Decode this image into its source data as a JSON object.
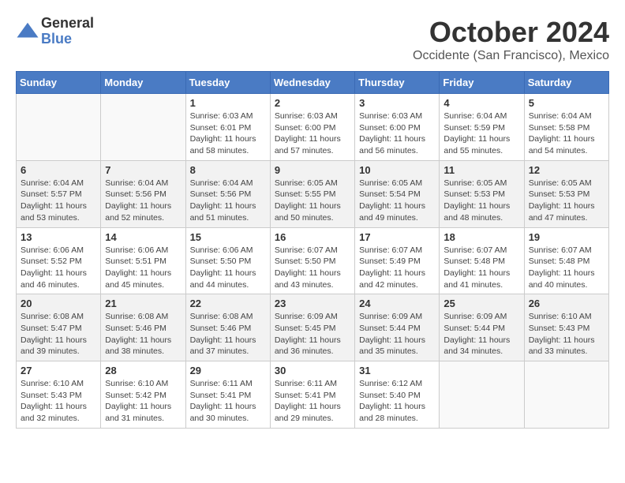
{
  "logo": {
    "general": "General",
    "blue": "Blue"
  },
  "title": "October 2024",
  "location": "Occidente (San Francisco), Mexico",
  "headers": [
    "Sunday",
    "Monday",
    "Tuesday",
    "Wednesday",
    "Thursday",
    "Friday",
    "Saturday"
  ],
  "weeks": [
    [
      {
        "day": "",
        "sunrise": "",
        "sunset": "",
        "daylight": ""
      },
      {
        "day": "",
        "sunrise": "",
        "sunset": "",
        "daylight": ""
      },
      {
        "day": "1",
        "sunrise": "Sunrise: 6:03 AM",
        "sunset": "Sunset: 6:01 PM",
        "daylight": "Daylight: 11 hours and 58 minutes."
      },
      {
        "day": "2",
        "sunrise": "Sunrise: 6:03 AM",
        "sunset": "Sunset: 6:00 PM",
        "daylight": "Daylight: 11 hours and 57 minutes."
      },
      {
        "day": "3",
        "sunrise": "Sunrise: 6:03 AM",
        "sunset": "Sunset: 6:00 PM",
        "daylight": "Daylight: 11 hours and 56 minutes."
      },
      {
        "day": "4",
        "sunrise": "Sunrise: 6:04 AM",
        "sunset": "Sunset: 5:59 PM",
        "daylight": "Daylight: 11 hours and 55 minutes."
      },
      {
        "day": "5",
        "sunrise": "Sunrise: 6:04 AM",
        "sunset": "Sunset: 5:58 PM",
        "daylight": "Daylight: 11 hours and 54 minutes."
      }
    ],
    [
      {
        "day": "6",
        "sunrise": "Sunrise: 6:04 AM",
        "sunset": "Sunset: 5:57 PM",
        "daylight": "Daylight: 11 hours and 53 minutes."
      },
      {
        "day": "7",
        "sunrise": "Sunrise: 6:04 AM",
        "sunset": "Sunset: 5:56 PM",
        "daylight": "Daylight: 11 hours and 52 minutes."
      },
      {
        "day": "8",
        "sunrise": "Sunrise: 6:04 AM",
        "sunset": "Sunset: 5:56 PM",
        "daylight": "Daylight: 11 hours and 51 minutes."
      },
      {
        "day": "9",
        "sunrise": "Sunrise: 6:05 AM",
        "sunset": "Sunset: 5:55 PM",
        "daylight": "Daylight: 11 hours and 50 minutes."
      },
      {
        "day": "10",
        "sunrise": "Sunrise: 6:05 AM",
        "sunset": "Sunset: 5:54 PM",
        "daylight": "Daylight: 11 hours and 49 minutes."
      },
      {
        "day": "11",
        "sunrise": "Sunrise: 6:05 AM",
        "sunset": "Sunset: 5:53 PM",
        "daylight": "Daylight: 11 hours and 48 minutes."
      },
      {
        "day": "12",
        "sunrise": "Sunrise: 6:05 AM",
        "sunset": "Sunset: 5:53 PM",
        "daylight": "Daylight: 11 hours and 47 minutes."
      }
    ],
    [
      {
        "day": "13",
        "sunrise": "Sunrise: 6:06 AM",
        "sunset": "Sunset: 5:52 PM",
        "daylight": "Daylight: 11 hours and 46 minutes."
      },
      {
        "day": "14",
        "sunrise": "Sunrise: 6:06 AM",
        "sunset": "Sunset: 5:51 PM",
        "daylight": "Daylight: 11 hours and 45 minutes."
      },
      {
        "day": "15",
        "sunrise": "Sunrise: 6:06 AM",
        "sunset": "Sunset: 5:50 PM",
        "daylight": "Daylight: 11 hours and 44 minutes."
      },
      {
        "day": "16",
        "sunrise": "Sunrise: 6:07 AM",
        "sunset": "Sunset: 5:50 PM",
        "daylight": "Daylight: 11 hours and 43 minutes."
      },
      {
        "day": "17",
        "sunrise": "Sunrise: 6:07 AM",
        "sunset": "Sunset: 5:49 PM",
        "daylight": "Daylight: 11 hours and 42 minutes."
      },
      {
        "day": "18",
        "sunrise": "Sunrise: 6:07 AM",
        "sunset": "Sunset: 5:48 PM",
        "daylight": "Daylight: 11 hours and 41 minutes."
      },
      {
        "day": "19",
        "sunrise": "Sunrise: 6:07 AM",
        "sunset": "Sunset: 5:48 PM",
        "daylight": "Daylight: 11 hours and 40 minutes."
      }
    ],
    [
      {
        "day": "20",
        "sunrise": "Sunrise: 6:08 AM",
        "sunset": "Sunset: 5:47 PM",
        "daylight": "Daylight: 11 hours and 39 minutes."
      },
      {
        "day": "21",
        "sunrise": "Sunrise: 6:08 AM",
        "sunset": "Sunset: 5:46 PM",
        "daylight": "Daylight: 11 hours and 38 minutes."
      },
      {
        "day": "22",
        "sunrise": "Sunrise: 6:08 AM",
        "sunset": "Sunset: 5:46 PM",
        "daylight": "Daylight: 11 hours and 37 minutes."
      },
      {
        "day": "23",
        "sunrise": "Sunrise: 6:09 AM",
        "sunset": "Sunset: 5:45 PM",
        "daylight": "Daylight: 11 hours and 36 minutes."
      },
      {
        "day": "24",
        "sunrise": "Sunrise: 6:09 AM",
        "sunset": "Sunset: 5:44 PM",
        "daylight": "Daylight: 11 hours and 35 minutes."
      },
      {
        "day": "25",
        "sunrise": "Sunrise: 6:09 AM",
        "sunset": "Sunset: 5:44 PM",
        "daylight": "Daylight: 11 hours and 34 minutes."
      },
      {
        "day": "26",
        "sunrise": "Sunrise: 6:10 AM",
        "sunset": "Sunset: 5:43 PM",
        "daylight": "Daylight: 11 hours and 33 minutes."
      }
    ],
    [
      {
        "day": "27",
        "sunrise": "Sunrise: 6:10 AM",
        "sunset": "Sunset: 5:43 PM",
        "daylight": "Daylight: 11 hours and 32 minutes."
      },
      {
        "day": "28",
        "sunrise": "Sunrise: 6:10 AM",
        "sunset": "Sunset: 5:42 PM",
        "daylight": "Daylight: 11 hours and 31 minutes."
      },
      {
        "day": "29",
        "sunrise": "Sunrise: 6:11 AM",
        "sunset": "Sunset: 5:41 PM",
        "daylight": "Daylight: 11 hours and 30 minutes."
      },
      {
        "day": "30",
        "sunrise": "Sunrise: 6:11 AM",
        "sunset": "Sunset: 5:41 PM",
        "daylight": "Daylight: 11 hours and 29 minutes."
      },
      {
        "day": "31",
        "sunrise": "Sunrise: 6:12 AM",
        "sunset": "Sunset: 5:40 PM",
        "daylight": "Daylight: 11 hours and 28 minutes."
      },
      {
        "day": "",
        "sunrise": "",
        "sunset": "",
        "daylight": ""
      },
      {
        "day": "",
        "sunrise": "",
        "sunset": "",
        "daylight": ""
      }
    ]
  ]
}
